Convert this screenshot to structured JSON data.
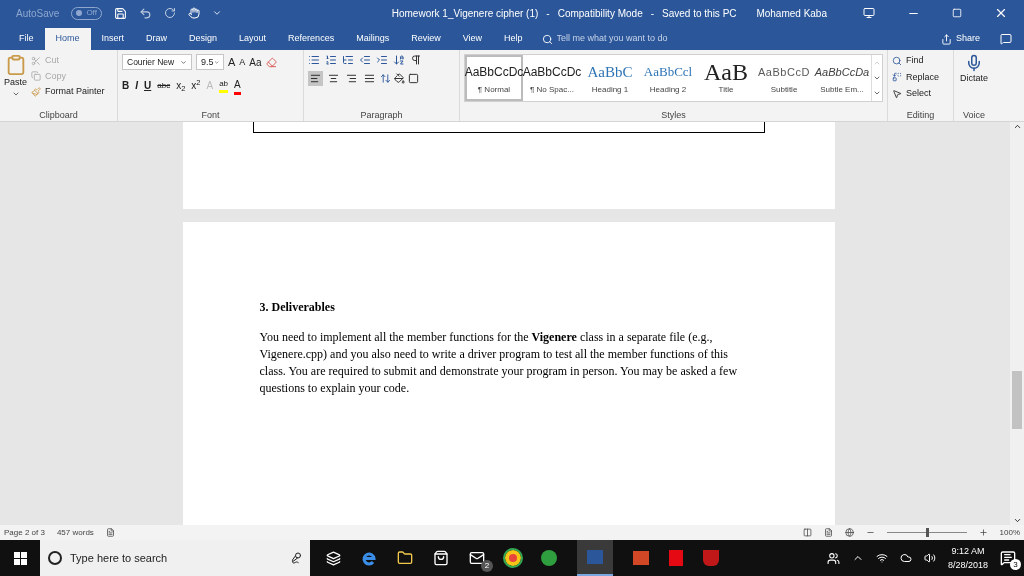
{
  "title_bar": {
    "separators": [
      "-",
      "-"
    ],
    "autosave": {
      "label": "AutoSave",
      "state": "Off",
      "on": false
    },
    "title": "Homework 1_Vigenere cipher (1)",
    "mode": "Compatibility Mode",
    "saved": "Saved to this PC",
    "user": "Mohamed Kaba"
  },
  "tabs": [
    {
      "label": "File",
      "selected": false
    },
    {
      "label": "Home",
      "selected": true
    },
    {
      "label": "Insert",
      "selected": false
    },
    {
      "label": "Draw",
      "selected": false
    },
    {
      "label": "Design",
      "selected": false
    },
    {
      "label": "Layout",
      "selected": false
    },
    {
      "label": "References",
      "selected": false
    },
    {
      "label": "Mailings",
      "selected": false
    },
    {
      "label": "Review",
      "selected": false
    },
    {
      "label": "View",
      "selected": false
    },
    {
      "label": "Help",
      "selected": false
    }
  ],
  "tell_me": {
    "placeholder": "Tell me what you want to do"
  },
  "share": "Share",
  "clipboard": {
    "paste": "Paste",
    "cut": {
      "label": "Cut",
      "disabled": true
    },
    "copy": {
      "label": "Copy",
      "disabled": true
    },
    "format_painter": "Format Painter",
    "label": "Clipboard"
  },
  "font": {
    "name": "Courier New",
    "size": "9.5",
    "grow": "A",
    "shrink": "A",
    "change_case": "Aa",
    "formatting": [
      "B",
      "I",
      "U",
      "abc",
      "x$_{2}$",
      "x$^{2}$"
    ],
    "effects": "A",
    "highlight": "ab",
    "text_color": "A",
    "label": "Font"
  },
  "paragraph": {
    "label": "Paragraph",
    "alignments": [
      {
        "selected": true
      },
      {
        "selected": false
      },
      {
        "selected": false
      },
      {
        "selected": false
      }
    ]
  },
  "styles": {
    "label": "Styles",
    "items": [
      {
        "preview": "AaBbCcDc",
        "name": "¶ Normal",
        "selected": true
      },
      {
        "preview": "AaBbCcDc",
        "name": "¶ No Spac...",
        "selected": false
      },
      {
        "preview": "AaBbC",
        "name": "Heading 1",
        "selected": false
      },
      {
        "preview": "AaBbCcl",
        "name": "Heading 2",
        "selected": false
      },
      {
        "preview": "AaB",
        "name": "Title",
        "selected": false
      },
      {
        "preview": "AaBbCcD",
        "name": "Subtitle",
        "selected": false
      },
      {
        "preview": "AaBbCcDa",
        "name": "Subtle Em...",
        "selected": false
      }
    ]
  },
  "editing": {
    "find": "Find",
    "replace": "Replace",
    "select": "Select",
    "label": "Editing"
  },
  "voice": {
    "dictate": "Dictate",
    "label": "Voice"
  },
  "document": {
    "heading": "3. Deliverables",
    "paragraph": "You need to implement all the member functions for the **Vigenere** class in a separate file (e.g., Vigenere.cpp) and you also need to write a driver program to test all the member functions of this class. You are required to submit and demonstrate your program in person. You may be asked a few questions to explain your code."
  },
  "status_bar": {
    "page": "Page 2 of 3",
    "words": "457 words",
    "zoom": "100%",
    "zoom_level": {
      "level": 0.5
    }
  },
  "taskbar": {
    "search": {
      "placeholder": "Type here to search"
    },
    "mail_badge": "2",
    "time": "9:12 AM",
    "date": "8/28/2018",
    "notifications": "3"
  }
}
